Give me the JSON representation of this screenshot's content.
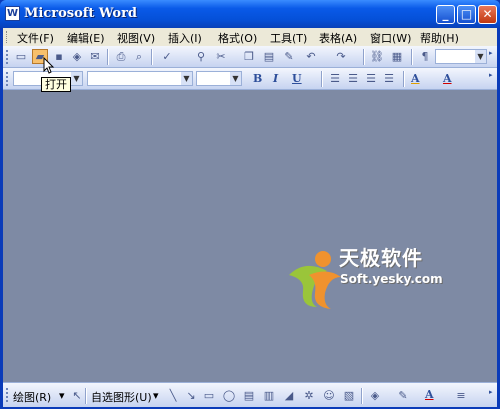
{
  "window": {
    "title": "Microsoft Word",
    "icon_letter": "W",
    "buttons": {
      "minimize": "_",
      "maximize": "□",
      "close": "✕"
    }
  },
  "menubar": {
    "items": [
      {
        "label": "文件(F)"
      },
      {
        "label": "编辑(E)"
      },
      {
        "label": "视图(V)"
      },
      {
        "label": "插入(I)"
      },
      {
        "label": "格式(O)"
      },
      {
        "label": "工具(T)"
      },
      {
        "label": "表格(A)"
      },
      {
        "label": "窗口(W)"
      },
      {
        "label": "帮助(H)"
      }
    ]
  },
  "standard_toolbar": {
    "icons": [
      "new-icon",
      "open-icon",
      "save-icon",
      "permission-icon",
      "email-icon",
      "print-icon",
      "print-preview-icon",
      "spelling-icon",
      "research-icon",
      "cut-icon",
      "copy-icon",
      "paste-icon",
      "format-painter-icon",
      "undo-icon",
      "redo-icon",
      "hyperlink-icon",
      "tables-icon",
      "columns-icon",
      "show-hide-icon"
    ]
  },
  "tooltip": {
    "text": "打开"
  },
  "formatting_toolbar": {
    "style_value": "",
    "font_value": "",
    "size_value": "",
    "bold": "B",
    "italic": "I",
    "underline": "U",
    "font_color": "A"
  },
  "watermark": {
    "cn": "天极软件",
    "en": "Soft.yesky.com"
  },
  "drawing_toolbar": {
    "draw_label": "绘图(R)",
    "autoshapes_label": "自选图形(U)"
  },
  "colors": {
    "title_bar": "#0a5ae8",
    "workspace": "#7e8aa4",
    "menubar": "#ece9d8",
    "toolbar": "#c6d3f0",
    "active_button": "#f7c06c",
    "logo_orange": "#f0922e",
    "logo_green": "#9ac53a"
  }
}
